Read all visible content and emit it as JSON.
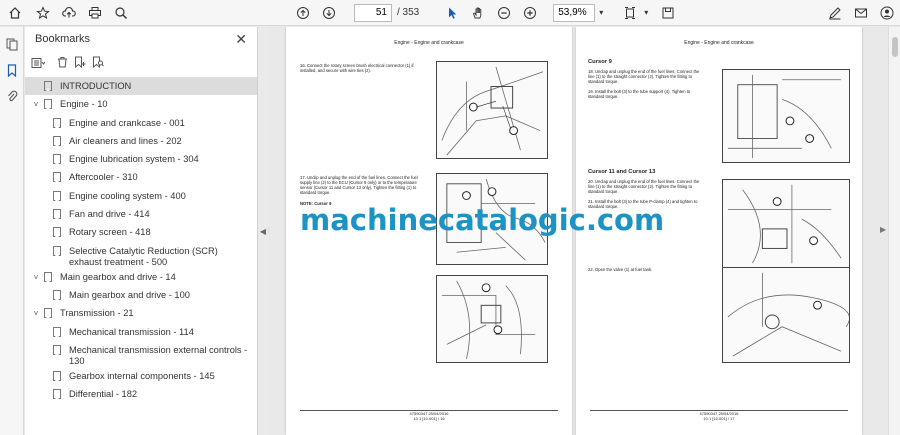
{
  "toolbar": {
    "page_current": "51",
    "page_total": "/ 353",
    "zoom": "53,9%"
  },
  "bookmarks": {
    "title": "Bookmarks",
    "items": [
      {
        "label": "INTRODUCTION",
        "level": 0,
        "caret": "",
        "selected": true
      },
      {
        "label": "Engine - 10",
        "level": 0,
        "caret": "˅"
      },
      {
        "label": "Engine and crankcase - 001",
        "level": 1,
        "caret": ""
      },
      {
        "label": "Air cleaners and lines - 202",
        "level": 1,
        "caret": ""
      },
      {
        "label": "Engine lubrication system - 304",
        "level": 1,
        "caret": ""
      },
      {
        "label": "Aftercooler - 310",
        "level": 1,
        "caret": ""
      },
      {
        "label": "Engine cooling system - 400",
        "level": 1,
        "caret": ""
      },
      {
        "label": "Fan and drive - 414",
        "level": 1,
        "caret": ""
      },
      {
        "label": "Rotary screen - 418",
        "level": 1,
        "caret": ""
      },
      {
        "label": "Selective Catalytic Reduction (SCR) exhaust treatment - 500",
        "level": 1,
        "caret": ""
      },
      {
        "label": "Main gearbox and drive - 14",
        "level": 0,
        "caret": "˅"
      },
      {
        "label": "Main gearbox and drive - 100",
        "level": 1,
        "caret": ""
      },
      {
        "label": "Transmission - 21",
        "level": 0,
        "caret": "˅"
      },
      {
        "label": "Mechanical transmission - 114",
        "level": 1,
        "caret": ""
      },
      {
        "label": "Mechanical transmission external controls - 130",
        "level": 1,
        "caret": ""
      },
      {
        "label": "Gearbox internal components - 145",
        "level": 1,
        "caret": ""
      },
      {
        "label": "Differential - 182",
        "level": 1,
        "caret": ""
      }
    ]
  },
  "left_page": {
    "header": "Engine - Engine and crankcase",
    "step16": "16.    Connect the rotary screen brush electrical connector (1) if installed, and secure with wire ties (2).",
    "step17": "17.    Unclip and unplug the end of the fuel lines. Connect the fuel supply line (2) to the ECU (Cursor 9 only) or to the temperature sensor (Cursor 11 and Cursor 13 only). Tighten the fitting (1) to standard torque.",
    "note": "NOTE: Cursor 9",
    "footer1": "47590347 25/04/2016",
    "footer2": "10.1 [10.001] / 16"
  },
  "right_page": {
    "header": "Engine - Engine and crankcase",
    "sec1": "Cursor 9",
    "step18": "18.    Unclap and unplug the end of the fuel lines. Connect the line (1) to the straight connector (2). Tighten the fitting to standard torque.",
    "step19": "19.    Install the bolt (3) to the tube support (4). Tighten to standard torque.",
    "sec2": "Cursor 11 and Cursor 13",
    "step20": "20.    Unclap and unplug the end of the fuel lines. Connect the line (1) to the straight connector (2). Tighten the fitting to standard torque.",
    "step21": "21.    Install the bolt (3) to the tube P-clamp (4) and tighten to standard torque.",
    "step22": "22.    Open the valve (1) at fuel tank.",
    "footer1": "47590347 25/04/2016",
    "footer2": "10.1 [10.001] / 17"
  },
  "watermark": "machinecatalogic.com"
}
